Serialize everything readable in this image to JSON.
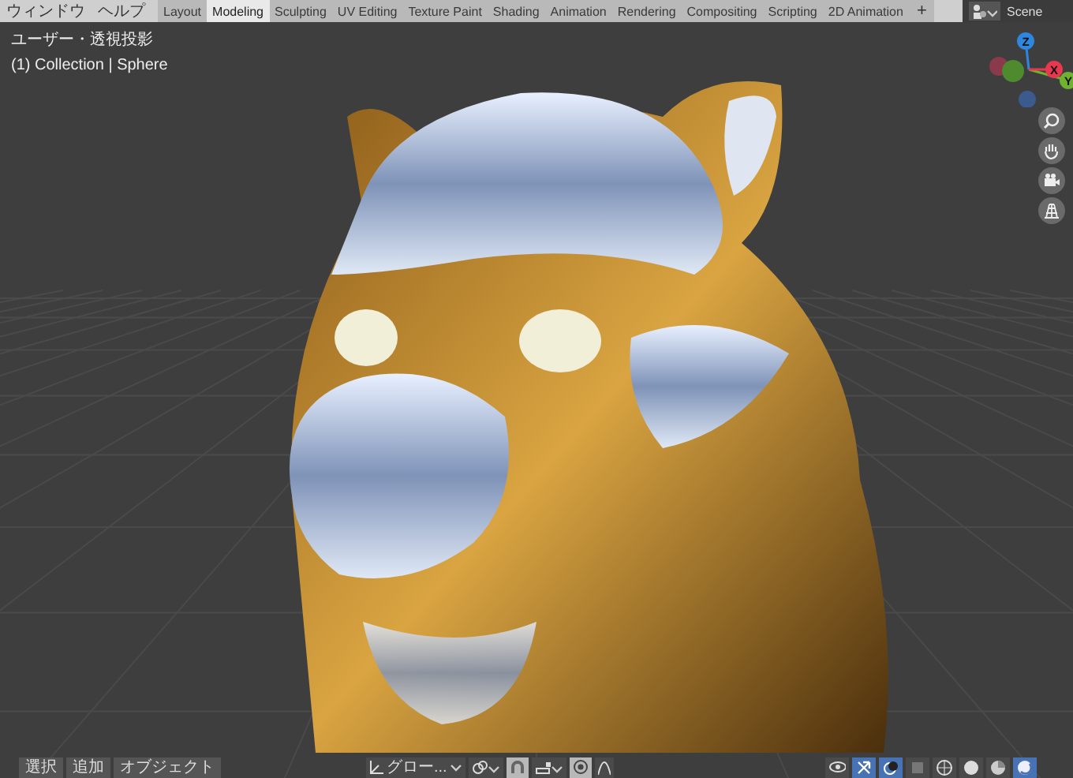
{
  "menus": [
    {
      "label": "ウィンドウ"
    },
    {
      "label": "ヘルプ"
    }
  ],
  "workspace_tabs": [
    {
      "label": "Layout",
      "selected": false
    },
    {
      "label": "Modeling",
      "selected": true
    },
    {
      "label": "Sculpting",
      "selected": false
    },
    {
      "label": "UV Editing",
      "selected": false
    },
    {
      "label": "Texture Paint",
      "selected": false
    },
    {
      "label": "Shading",
      "selected": false
    },
    {
      "label": "Animation",
      "selected": false
    },
    {
      "label": "Rendering",
      "selected": false
    },
    {
      "label": "Compositing",
      "selected": false
    },
    {
      "label": "Scripting",
      "selected": false
    },
    {
      "label": "2D Animation",
      "selected": false
    }
  ],
  "add_tab": "+",
  "scene": {
    "name": "Scene"
  },
  "viewport": {
    "view_label": "ユーザー・透視投影",
    "object_label": "(1) Collection | Sphere",
    "gizmo_axes": [
      {
        "label": "Z",
        "color": "#2e86de"
      },
      {
        "label": "Y",
        "color": "#6fb22f"
      },
      {
        "label": "X",
        "color": "#e8384f"
      }
    ],
    "nav_buttons": [
      {
        "kind": "zoom"
      },
      {
        "kind": "pan"
      },
      {
        "kind": "camera"
      },
      {
        "kind": "ortho"
      }
    ]
  },
  "header_menus": [
    {
      "label": "選択"
    },
    {
      "label": "追加"
    },
    {
      "label": "オブジェクト"
    }
  ],
  "orientation": {
    "label": "グロー..."
  },
  "snapping": {
    "on": true
  },
  "proportional_editing": {
    "on": true
  },
  "viewport_toggles": [
    {
      "kind": "visibility",
      "on": false
    },
    {
      "kind": "gizmos",
      "on": true
    },
    {
      "kind": "overlays",
      "on": true
    },
    {
      "kind": "xray",
      "on": false
    }
  ],
  "shading_modes": [
    {
      "kind": "wireframe",
      "selected": false
    },
    {
      "kind": "solid",
      "selected": false
    },
    {
      "kind": "material",
      "selected": false
    },
    {
      "kind": "rendered",
      "selected": true
    }
  ]
}
